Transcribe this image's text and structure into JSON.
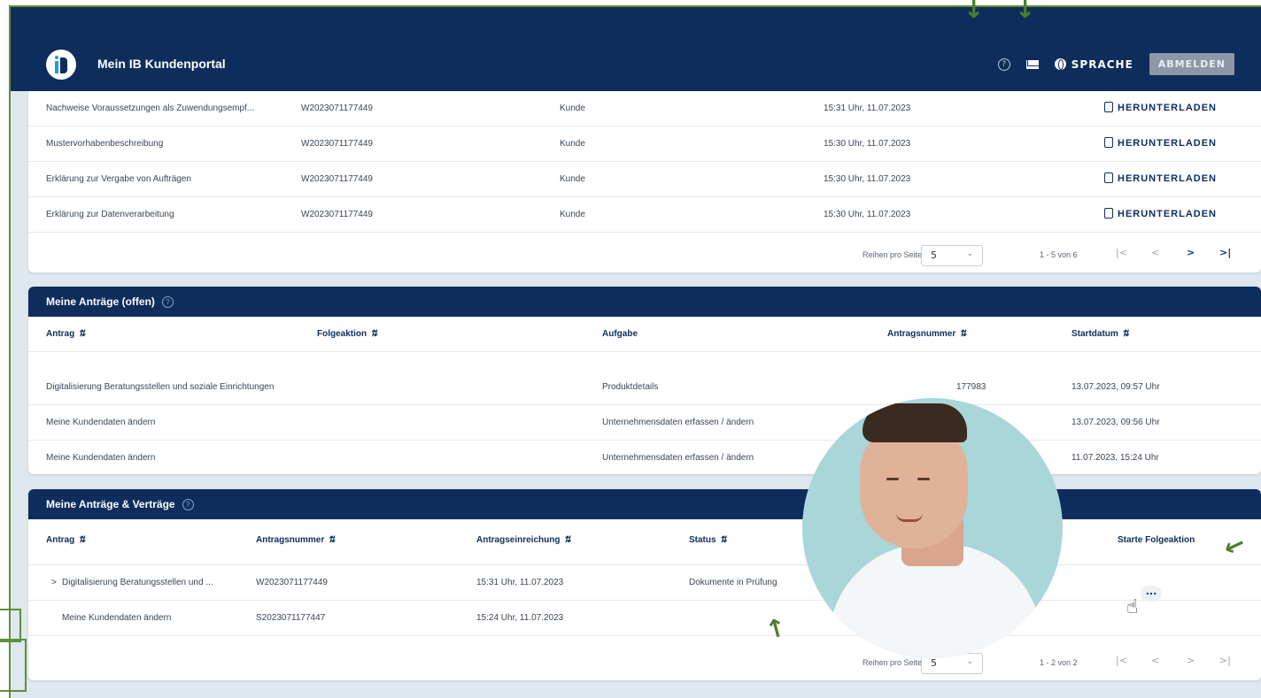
{
  "header": {
    "title": "Mein IB Kundenportal",
    "language_label": "SPRACHE",
    "logout_label": "ABMELDEN"
  },
  "documents": {
    "rows": [
      {
        "name": "Nachweise Voraussetzungen als Zuwendungsempf...",
        "number": "W2023071177449",
        "role": "Kunde",
        "time": "15:31 Uhr, 11.07.2023",
        "action": "HERUNTERLADEN"
      },
      {
        "name": "Mustervorhabenbeschreibung",
        "number": "W2023071177449",
        "role": "Kunde",
        "time": "15:30 Uhr, 11.07.2023",
        "action": "HERUNTERLADEN"
      },
      {
        "name": "Erklärung zur Vergabe von Aufträgen",
        "number": "W2023071177449",
        "role": "Kunde",
        "time": "15:30 Uhr, 11.07.2023",
        "action": "HERUNTERLADEN"
      },
      {
        "name": "Erklärung zur Datenverarbeitung",
        "number": "W2023071177449",
        "role": "Kunde",
        "time": "15:30 Uhr, 11.07.2023",
        "action": "HERUNTERLADEN"
      }
    ],
    "pager": {
      "rows_label": "Reihen pro Seite",
      "page_size": "5",
      "range": "1 - 5 von 6"
    }
  },
  "open_requests": {
    "title": "Meine Anträge (offen)",
    "columns": [
      "Antrag",
      "Folgeaktion",
      "Aufgabe",
      "Antragsnummer",
      "Startdatum"
    ],
    "rows": [
      {
        "antrag": "Digitalisierung Beratungsstellen und soziale Einrichtungen",
        "aufgabe": "Produktdetails",
        "nummer": "177983",
        "start": "13.07.2023, 09:57 Uhr"
      },
      {
        "antrag": "Meine Kundendaten ändern",
        "aufgabe": "Unternehmensdaten erfassen / ändern",
        "nummer": "",
        "start": "13.07.2023, 09:56 Uhr"
      },
      {
        "antrag": "Meine Kundendaten ändern",
        "aufgabe": "Unternehmensdaten erfassen / ändern",
        "nummer": "",
        "start": "11.07.2023, 15:24 Uhr"
      }
    ]
  },
  "contracts": {
    "title": "Meine Anträge & Verträge",
    "columns": [
      "Antrag",
      "Antragsnummer",
      "Antragseinreichung",
      "Status",
      "Starte Folgeaktion"
    ],
    "rows": [
      {
        "antrag": "Digitalisierung Beratungsstellen und ...",
        "nummer": "W2023071177449",
        "eingereicht": "15:31 Uhr, 11.07.2023",
        "status": "Dokumente in Prüfung",
        "expand": ">"
      },
      {
        "antrag": "Meine Kundendaten ändern",
        "nummer": "S2023071177447",
        "eingereicht": "15:24 Uhr, 11.07.2023",
        "status": "",
        "expand": ""
      }
    ],
    "pager": {
      "rows_label": "Reihen pro Seite",
      "page_size": "5",
      "range": "1 - 2 von 2"
    },
    "action_dots": "..."
  },
  "icons": {
    "help": "help-circle-icon",
    "mail": "mail-icon",
    "globe": "globe-icon",
    "download": "download-icon",
    "sort": "sort-arrows-icon",
    "cursor": "hand-pointer-icon",
    "arrow": "annotation-arrow-icon"
  },
  "colors": {
    "navy": "#0e2d5c",
    "annotation_green": "#4f7d2c",
    "page_bg": "#dfe7ef"
  }
}
